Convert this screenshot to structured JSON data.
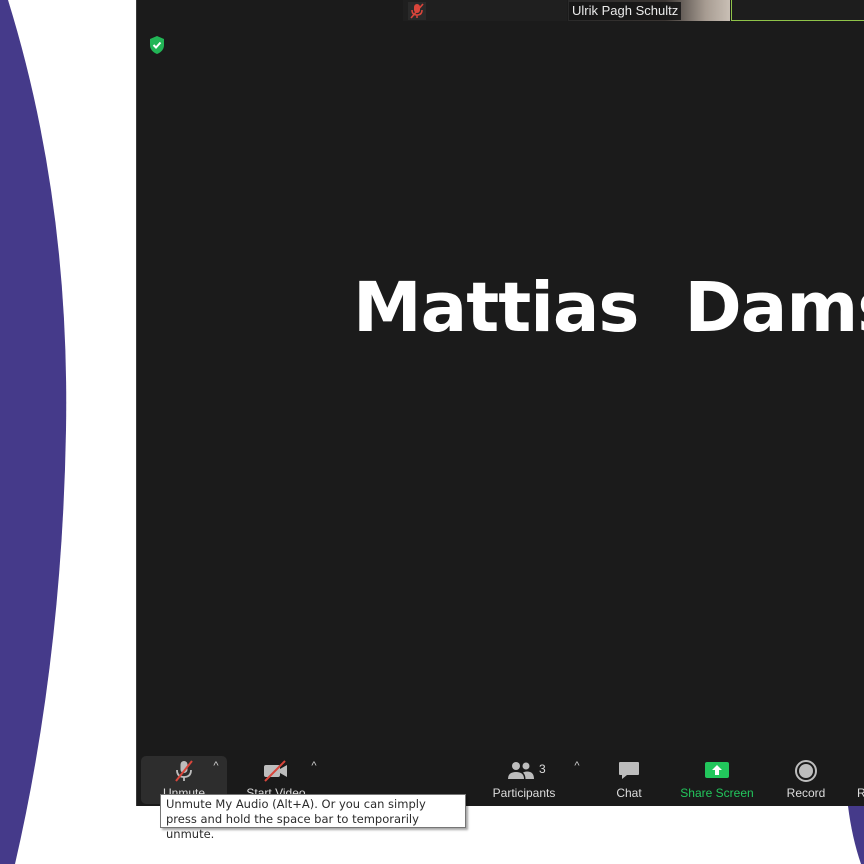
{
  "colors": {
    "background_purple": "#453a8a",
    "window_bg": "#1b1b1b",
    "toolbar_bg": "#1a1a1a",
    "share_screen_green": "#22c65c",
    "muted_red": "#d9453b",
    "shield_green": "#22b556",
    "active_thumb_border": "#8fc349"
  },
  "thumbnails": {
    "second_name": "Ulrik Pagh Schultz"
  },
  "main": {
    "speaker_name": "Mattias  Damsga"
  },
  "toolbar": {
    "unmute_label": "Unmute",
    "start_video_label": "Start Video",
    "participants_label": "Participants",
    "participants_count": "3",
    "chat_label": "Chat",
    "share_screen_label": "Share Screen",
    "record_label": "Record",
    "caret_glyph": "^",
    "cut_off_label": "R"
  },
  "tooltip": {
    "text": "Unmute My Audio (Alt+A). Or you can simply press and hold the space bar to temporarily unmute."
  },
  "icons": {
    "security": "shield-check-icon",
    "muted_mic": "microphone-off-icon",
    "video_off": "video-camera-off-icon",
    "participants": "people-icon",
    "chat": "chat-bubble-icon",
    "share": "share-screen-icon",
    "record": "record-icon"
  }
}
